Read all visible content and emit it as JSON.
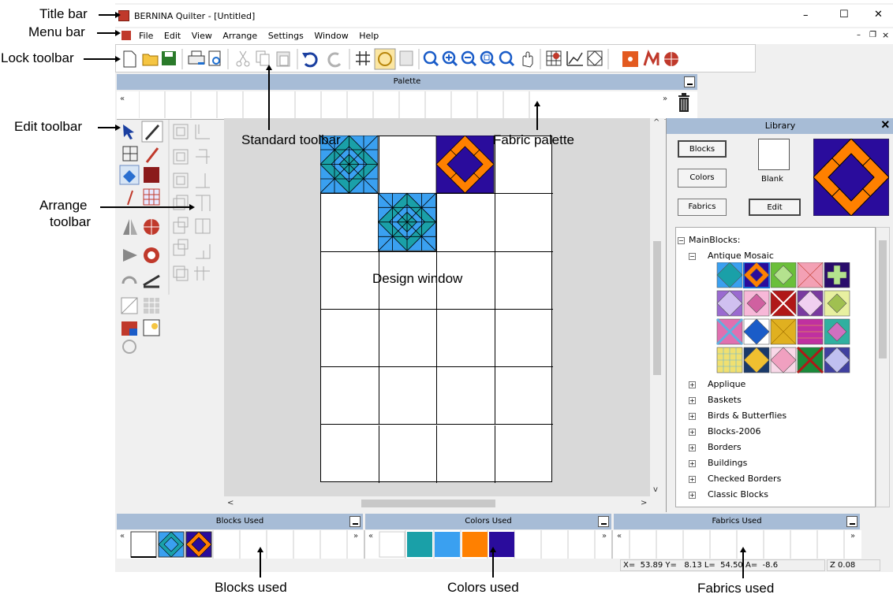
{
  "window": {
    "title": "BERNINA Quilter - [Untitled]",
    "controls": {
      "minimize": "–",
      "maximize": "☐",
      "close": "✕"
    },
    "mdi_controls": {
      "minimize": "–",
      "restore": "❐",
      "close": "×"
    }
  },
  "menu": {
    "items": [
      "File",
      "Edit",
      "View",
      "Arrange",
      "Settings",
      "Window",
      "Help"
    ]
  },
  "palette": {
    "title": "Palette",
    "scroll_left": "«",
    "scroll_right": "»"
  },
  "design": {
    "rows": 6,
    "cols": 4
  },
  "library": {
    "title": "Library",
    "close": "×",
    "buttons": {
      "blocks": "Blocks",
      "colors": "Colors",
      "fabrics": "Fabrics",
      "edit": "Edit"
    },
    "blank_label": "Blank",
    "tree": {
      "root": "MainBlocks:",
      "open_category": "Antique Mosaic",
      "categories": [
        "Applique",
        "Baskets",
        "Birds & Butterflies",
        "Blocks-2006",
        "Borders",
        "Buildings",
        "Checked Borders",
        "Classic Blocks"
      ]
    }
  },
  "bottom_panels": {
    "blocks_used": "Blocks Used",
    "colors_used": "Colors Used",
    "fabrics_used": "Fabrics Used"
  },
  "colors_used_swatches": [
    "#ffffff",
    "#1aa0a8",
    "#3aa0f0",
    "#ff8000",
    "#2a0c9c"
  ],
  "status": {
    "coords": "X=  53.89 Y=   8.13 L=  54.50 A=  -8.6",
    "zoom": "Z 0.08"
  },
  "annotations": {
    "title_bar": "Title bar",
    "menu_bar": "Menu bar",
    "lock_toolbar": "Lock toolbar",
    "edit_toolbar": "Edit toolbar",
    "arrange_toolbar_1": "Arrange",
    "arrange_toolbar_2": "toolbar",
    "standard_toolbar": "Standard toolbar",
    "fabric_palette": "Fabric palette",
    "design_window": "Design window",
    "blocks_used": "Blocks used",
    "colors_used": "Colors used",
    "fabrics_used": "Fabrics used"
  },
  "colors": {
    "teal": "#1aa0a8",
    "blue": "#3aa0f0",
    "orange": "#ff8000",
    "indigo": "#2a0c9c",
    "panel_header": "#a7bcd6"
  }
}
